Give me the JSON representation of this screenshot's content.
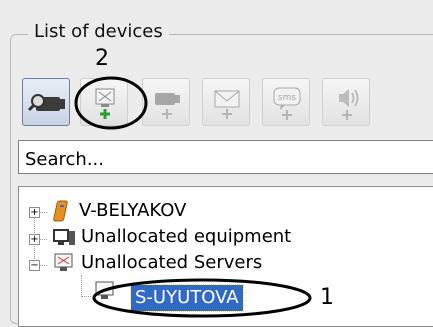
{
  "panel": {
    "title": "List of devices"
  },
  "toolbar": {
    "buttons": [
      {
        "name": "camera-search-button",
        "icon": "camera-search-icon",
        "enabled": true
      },
      {
        "name": "add-server-button",
        "icon": "server-plus-icon",
        "enabled": true
      },
      {
        "name": "add-camera-button",
        "icon": "camera-plus-icon",
        "enabled": false
      },
      {
        "name": "add-mail-button",
        "icon": "mail-plus-icon",
        "enabled": false
      },
      {
        "name": "add-sms-button",
        "icon": "sms-plus-icon",
        "enabled": false
      },
      {
        "name": "add-speaker-button",
        "icon": "speaker-plus-icon",
        "enabled": false
      }
    ]
  },
  "search": {
    "value": "Search..."
  },
  "tree": {
    "items": [
      {
        "label": "V-BELYAKOV",
        "icon": "server-orange-icon",
        "expander": "+"
      },
      {
        "label": "Unallocated equipment",
        "icon": "devices-icon",
        "expander": "+"
      },
      {
        "label": "Unallocated Servers",
        "icon": "server-monitor-icon",
        "expander": "-"
      },
      {
        "label": "S-UYUTOVA",
        "icon": "monitor-icon",
        "selected": true
      }
    ]
  },
  "annotations": {
    "step1": "1",
    "step2": "2"
  },
  "colors": {
    "selection": "#316ac5",
    "annotation": "#000000"
  }
}
